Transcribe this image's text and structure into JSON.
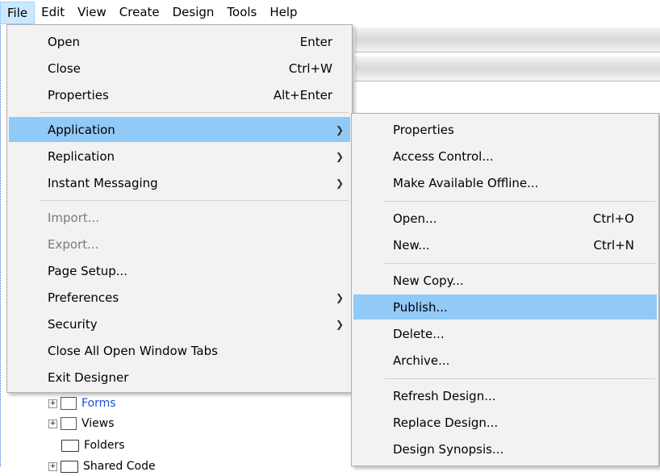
{
  "menubar": {
    "items": [
      "File",
      "Edit",
      "View",
      "Create",
      "Design",
      "Tools",
      "Help"
    ]
  },
  "file_menu": {
    "open": {
      "label": "Open",
      "shortcut": "Enter"
    },
    "close": {
      "label": "Close",
      "shortcut": "Ctrl+W"
    },
    "properties": {
      "label": "Properties",
      "shortcut": "Alt+Enter"
    },
    "application": {
      "label": "Application"
    },
    "replication": {
      "label": "Replication"
    },
    "instant_messaging": {
      "label": "Instant Messaging"
    },
    "import": {
      "label": "Import..."
    },
    "export": {
      "label": "Export..."
    },
    "page_setup": {
      "label": "Page Setup..."
    },
    "preferences": {
      "label": "Preferences"
    },
    "security": {
      "label": "Security"
    },
    "close_all_tabs": {
      "label": "Close All Open Window Tabs"
    },
    "exit": {
      "label": "Exit Designer"
    }
  },
  "application_submenu": {
    "properties": {
      "label": "Properties"
    },
    "access_control": {
      "label": "Access Control..."
    },
    "make_available_offline": {
      "label": "Make Available Offline..."
    },
    "open": {
      "label": "Open...",
      "shortcut": "Ctrl+O"
    },
    "new": {
      "label": "New...",
      "shortcut": "Ctrl+N"
    },
    "new_copy": {
      "label": "New Copy..."
    },
    "publish": {
      "label": "Publish..."
    },
    "delete": {
      "label": "Delete..."
    },
    "archive": {
      "label": "Archive..."
    },
    "refresh_design": {
      "label": "Refresh Design..."
    },
    "replace_design": {
      "label": "Replace Design..."
    },
    "design_synopsis": {
      "label": "Design Synopsis..."
    }
  },
  "tree": {
    "forms": "Forms",
    "views": "Views",
    "folders": "Folders",
    "shared_code": "Shared Code"
  },
  "colors": {
    "highlight": "#91c9f7",
    "link": "#1a4fd6"
  }
}
